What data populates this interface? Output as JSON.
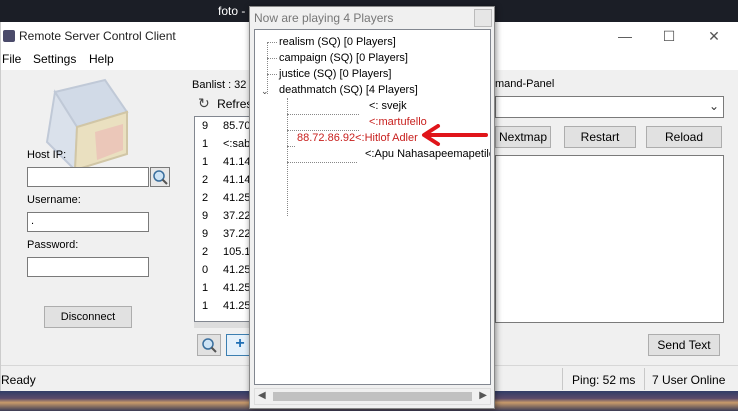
{
  "background": {
    "title_fragment": "foto -"
  },
  "window": {
    "title": "Remote Server Control Client",
    "controls": {
      "minimize": "—",
      "maximize": "☐",
      "close": "✕"
    }
  },
  "menu": [
    "File",
    "Settings",
    "Help"
  ],
  "login": {
    "host_label": "Host IP:",
    "host_value": "",
    "username_label": "Username:",
    "username_value": ".",
    "password_label": "Password:",
    "password_value": "",
    "disconnect_label": "Disconnect"
  },
  "banlist": {
    "title": "Banlist : 32",
    "refresh_label": "Refres",
    "rows": [
      {
        "num": "9",
        "ip": "85.70"
      },
      {
        "num": "1",
        "ip": "<:sab"
      },
      {
        "num": "1",
        "ip": "41.14"
      },
      {
        "num": "2",
        "ip": "41.14"
      },
      {
        "num": "2",
        "ip": "41.25"
      },
      {
        "num": "9",
        "ip": "37.22"
      },
      {
        "num": "9",
        "ip": "37.22"
      },
      {
        "num": "2",
        "ip": "105.1"
      },
      {
        "num": "0",
        "ip": "41.25"
      },
      {
        "num": "1",
        "ip": "41.25"
      },
      {
        "num": "1",
        "ip": "41.25"
      }
    ],
    "add_label": "+"
  },
  "command_panel": {
    "title": "mand-Panel",
    "select_value": "",
    "buttons": {
      "nextmap": "Nextmap",
      "restart": "Restart",
      "reload": "Reload"
    },
    "send_text_label": "Send Text"
  },
  "status": {
    "ready": "Ready",
    "ping": "Ping: 52 ms",
    "users": "7 User Online"
  },
  "popup": {
    "title": "Now are playing 4 Players",
    "tree": [
      {
        "label": "realism (SQ) [0 Players]"
      },
      {
        "label": "campaign (SQ) [0 Players]"
      },
      {
        "label": "justice (SQ) [0 Players]"
      },
      {
        "label": "deathmatch (SQ) [4 Players]"
      }
    ],
    "players": [
      {
        "text": "<:    svejk",
        "highlight": false
      },
      {
        "text": "<:martufello",
        "highlight": true
      },
      {
        "text": "88.72.86.92<:Hitlof Adler",
        "highlight": true
      },
      {
        "text": "<:Apu Nahasapeemapetilor",
        "highlight": false
      }
    ]
  },
  "colors": {
    "highlight_player": "#c8201e",
    "annotation_arrow": "#e0151a",
    "accent_button": "#1f6fb5"
  }
}
